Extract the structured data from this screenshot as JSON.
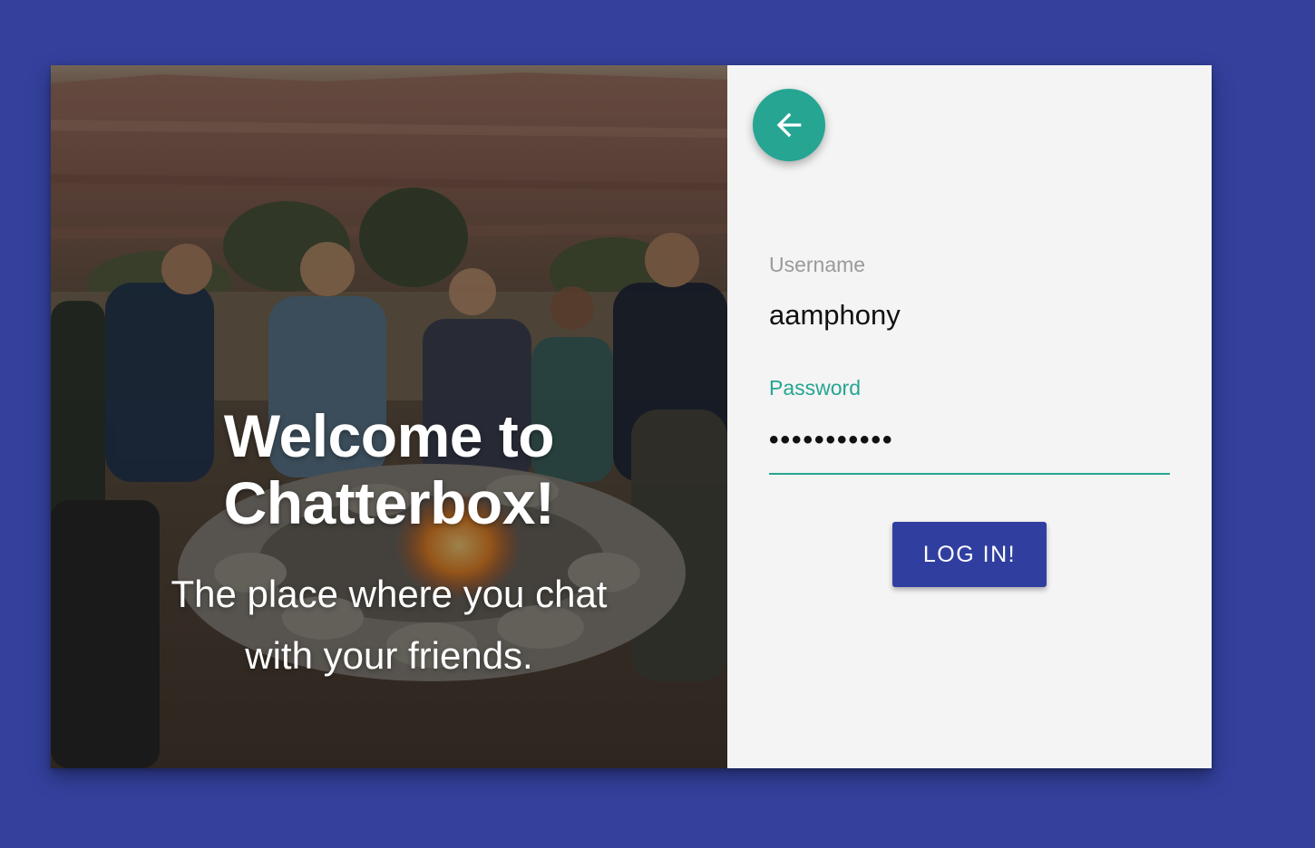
{
  "hero": {
    "title_line1": "Welcome to",
    "title_line2": "Chatterbox!",
    "subtitle_line1": "The place where you chat",
    "subtitle_line2": "with your friends.",
    "image_description_icon": "campfire-group-photo"
  },
  "form": {
    "back_icon": "arrow-left-icon",
    "username": {
      "label": "Username",
      "value": "aamphony"
    },
    "password": {
      "label": "Password",
      "value": "•••••••••••"
    },
    "login_label": "LOG IN!"
  },
  "colors": {
    "background": "#33419d",
    "accent_teal": "#26a593",
    "button_primary": "#303f9f",
    "panel_bg": "#f4f4f4"
  }
}
